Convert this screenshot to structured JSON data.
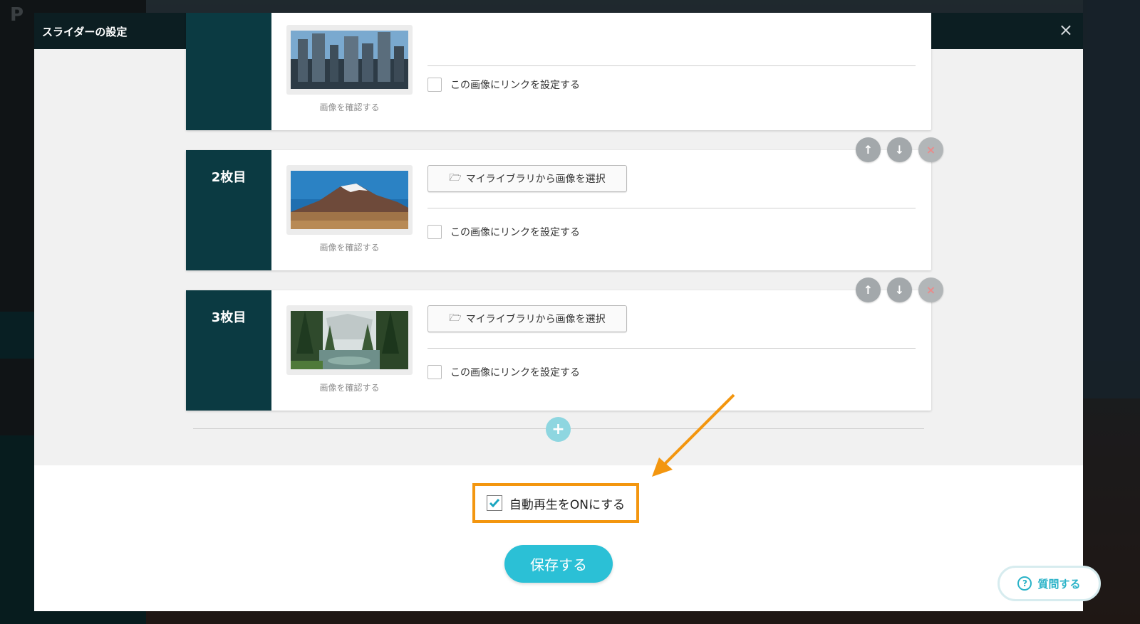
{
  "modal": {
    "title": "スライダーの設定",
    "close_symbol": "×"
  },
  "slides": [
    {
      "label": "",
      "confirm_label": "画像を確認する",
      "link_label": "この画像にリンクを設定する",
      "link_checked": false,
      "thumbnail": "city-skyline-image"
    },
    {
      "label": "2枚目",
      "select_label": "マイライブラリから画像を選択",
      "confirm_label": "画像を確認する",
      "link_label": "この画像にリンクを設定する",
      "link_checked": false,
      "thumbnail": "mountain-desert-image"
    },
    {
      "label": "3枚目",
      "select_label": "マイライブラリから画像を選択",
      "confirm_label": "画像を確認する",
      "link_label": "この画像にリンクを設定する",
      "link_checked": false,
      "thumbnail": "forest-lake-image"
    }
  ],
  "controls": {
    "up_symbol": "↑",
    "down_symbol": "↓",
    "delete_symbol": "×",
    "add_symbol": "+"
  },
  "autoplay": {
    "label": "自動再生をONにする",
    "checked": true
  },
  "save_label": "保存する",
  "help": {
    "label": "質問する",
    "icon_symbol": "?"
  },
  "colors": {
    "header": "#0c1e22",
    "slide_number_bg": "#0b3a42",
    "accent": "#2bc0d6",
    "highlight": "#f3960f"
  }
}
